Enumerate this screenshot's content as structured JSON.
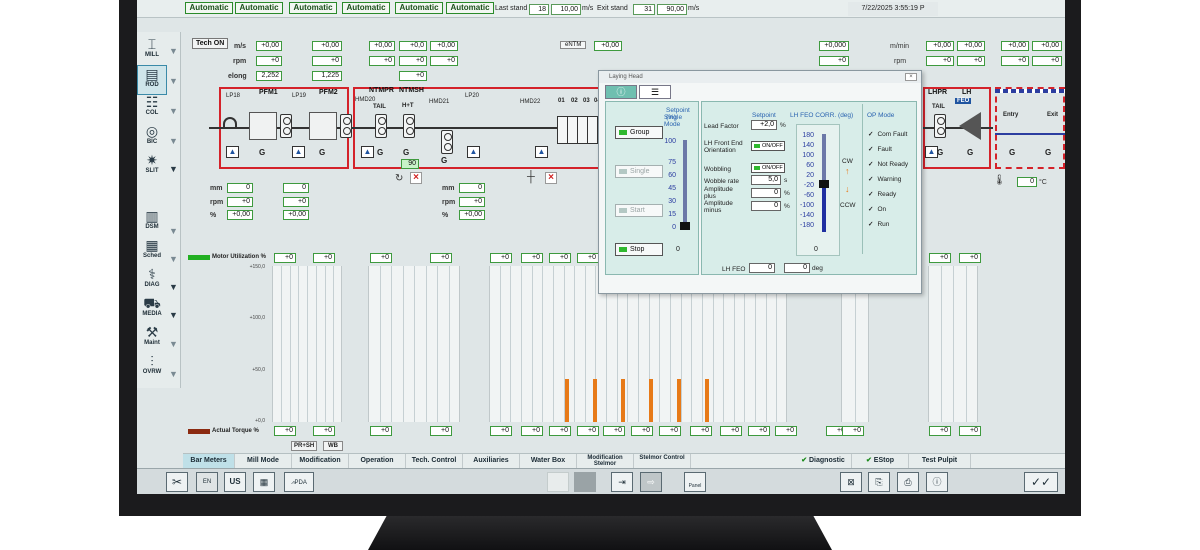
{
  "topbar": {
    "auto_buttons": [
      "Automatic",
      "Automatic",
      "Automatic",
      "Automatic",
      "Automatic",
      "Automatic"
    ],
    "last_stand_label": "Last stand",
    "last_stand_num": "18",
    "last_stand_speed": "10,00",
    "last_stand_unit": "m/s",
    "exit_stand_label": "Exit stand",
    "exit_stand_num": "31",
    "exit_stand_speed": "90,00",
    "exit_stand_unit": "m/s",
    "datetime": "7/22/2025 3:55:19 P"
  },
  "nav": {
    "items": [
      {
        "label": "MILL",
        "icon": "mill-icon"
      },
      {
        "label": "ROD",
        "icon": "rod-icon"
      },
      {
        "label": "COL",
        "icon": "coil-icon"
      },
      {
        "label": "BIC",
        "icon": "bic-icon"
      },
      {
        "label": "SLIT",
        "icon": "slit-icon"
      },
      {
        "label": "DSM",
        "icon": "dsm-icon"
      },
      {
        "label": "Sched",
        "icon": "schedule-icon"
      },
      {
        "label": "DIAG",
        "icon": "diag-icon"
      },
      {
        "label": "MEDIA",
        "icon": "media-icon"
      },
      {
        "label": "Maint",
        "icon": "maint-icon"
      },
      {
        "label": "OVRW",
        "icon": "overview-icon"
      }
    ]
  },
  "mimic": {
    "tech_on": "Tech ON",
    "units": {
      "ms": "m/s",
      "rpm": "rpm",
      "elong": "elong",
      "mm": "mm",
      "pct": "%",
      "mmin": "m/min"
    },
    "top_values": {
      "pfm1_ms": "+0,00",
      "pfm2_ms": "+0,00",
      "nt_ms1": "+0,00",
      "nt_ms2": "+0,0",
      "nt_ms3": "+0,00",
      "pfm1_rpm": "+0",
      "pfm2_rpm": "+0",
      "nt_rpm1": "+0",
      "nt_rpm2": "+0",
      "nt_rpm3": "+0",
      "pfm1_elong": "2,252",
      "pfm2_elong": "1,225",
      "nt_elong": "+0",
      "entm_label": "eNTM",
      "entm_val": "+0,00",
      "rb_ms": "+0,000",
      "rb_mmin_1": "+0,00",
      "rb_mmin_2": "+0,00",
      "rb_mmin_3": "+0,00",
      "rb_mmin_4": "+0,00",
      "rb_rpm": "+0",
      "rb_rpm_1": "+0",
      "rb_rpm_2": "+0",
      "rb_rpm_3": "+0",
      "rb_rpm_4": "+0"
    },
    "stands": {
      "lp18": "LP18",
      "pfm1": "PFM1",
      "lp19": "LP19",
      "pfm2": "PFM2",
      "hmd20": "HMD20",
      "ntmpr": "NTMPR",
      "tail": "TAIL",
      "ntmsh": "NTMSH",
      "ht": "H+T",
      "hmd21": "HMD21",
      "lp20": "LP20",
      "hmd22": "HMD22",
      "rb_stands": [
        "01",
        "02",
        "03",
        "04"
      ],
      "lhpr": "LHPR",
      "lh": "LH",
      "feo": "FEO",
      "tail2": "TAIL",
      "entry": "Entry",
      "exit": "Exit"
    },
    "g_label": "G",
    "i_label": "I",
    "ntmsh_val": "90",
    "temp_val": "0",
    "temp_unit": "°C",
    "lower_values": {
      "mm1": "0",
      "mm2": "0",
      "rpm1": "+0",
      "rpm2": "+0",
      "pct1": "+0,00",
      "pct2": "+0,00",
      "mm3": "0",
      "rpm3": "+0",
      "pct3": "+0,00"
    }
  },
  "meters": {
    "motor_util_label": "Motor Utilization %",
    "actual_torque_label": "Actual Torque %",
    "scale": [
      "+150,0",
      "+100,0",
      "+50,0",
      "+0,0"
    ],
    "top_vals": [
      "+0",
      "+0",
      "+0",
      "+0",
      "+0",
      "+0",
      "+0",
      "+0",
      "+0",
      "+0",
      "+0",
      "+0",
      "+0",
      "+0",
      "+0",
      "+0",
      "+0",
      "+0",
      "+0",
      "+0",
      "+0"
    ],
    "bottom_vals": [
      "+0",
      "+0",
      "+0",
      "+0",
      "+0",
      "+0",
      "+0",
      "+0",
      "+0",
      "+0",
      "+0",
      "+0",
      "+0",
      "+0",
      "+0",
      "+0",
      "+0",
      "+0",
      "+0",
      "+0",
      "+0"
    ],
    "motor_color": "#22b022",
    "torque_color": "#8b2a10",
    "bar_color": "#e77a18",
    "tags": [
      "PR+SH",
      "WB"
    ]
  },
  "tabs": [
    {
      "label": "Bar Meters",
      "active": true
    },
    {
      "label": "Mill Mode"
    },
    {
      "label": "Modification"
    },
    {
      "label": "Operation"
    },
    {
      "label": "Tech. Control"
    },
    {
      "label": "Auxiliaries"
    },
    {
      "label": "Water Box"
    },
    {
      "label": "Modification Stelmor"
    },
    {
      "label": "Stelmor Control"
    },
    {
      "label": "Diagnostic"
    },
    {
      "label": "EStop"
    },
    {
      "label": "Test Pulpit"
    }
  ],
  "toolbar": {
    "lang_en": "EN",
    "lang_us": "US",
    "pda": "PDA",
    "panel": "Panel"
  },
  "dialog": {
    "title": "Laying Head",
    "close": "⊠",
    "tab1_icon": "info-icon",
    "tab2_icon": "list-icon",
    "setpoint_pct": "Setpoint (%)",
    "single_mode": "Single Mode",
    "buttons": {
      "group": "Group",
      "single": "Single",
      "start": "Start",
      "stop": "Stop"
    },
    "scale_left": [
      "100",
      "75",
      "60",
      "45",
      "30",
      "15",
      "0"
    ],
    "left_zero": "0",
    "lead_factor": "Lead Factor",
    "setpoint": "Setpoint",
    "lead_factor_val": "+2,0",
    "lead_factor_unit": "%",
    "front_end": "LH Front End Orientation",
    "onoff": "ON/OFF",
    "wobbling": "Wobbling",
    "wobble_rate": "Wobble rate",
    "wobble_rate_val": "5,0",
    "wobble_rate_unit": "s",
    "amp_plus": "Amplitude plus",
    "amp_plus_val": "0",
    "amp_minus": "Amplitude minus",
    "amp_minus_val": "0",
    "amp_unit": "%",
    "feo_corr": "LH FEO CORR. (deg)",
    "scale_right": [
      "180",
      "140",
      "100",
      "60",
      "20",
      "-20",
      "-60",
      "-100",
      "-140",
      "-180"
    ],
    "right_zero": "0",
    "cw": "CW",
    "ccw": "CCW",
    "op_mode": "OP Mode",
    "op_items": [
      "Com Fault",
      "Fault",
      "Not Ready",
      "Warning",
      "Ready",
      "On",
      "Run"
    ],
    "lh_feo": "LH FEO",
    "lh_feo_val1": "0",
    "lh_feo_val2": "0",
    "lh_feo_unit": "deg"
  }
}
